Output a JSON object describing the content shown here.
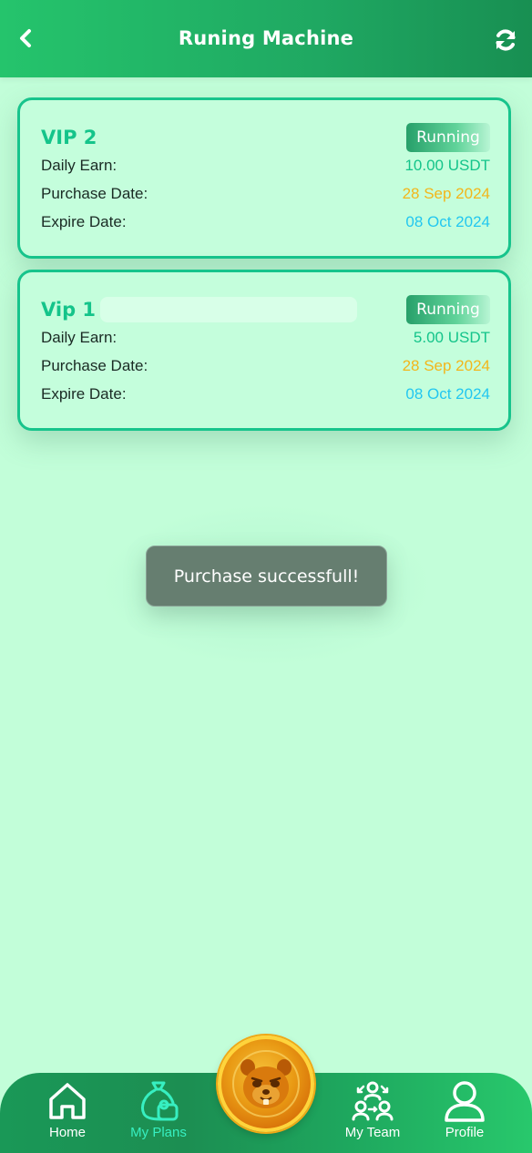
{
  "header": {
    "title": "Runing Machine",
    "back_icon": "chevron-left-icon",
    "refresh_icon": "refresh-icon"
  },
  "plans": [
    {
      "name": "VIP 2",
      "status": "Running",
      "rows": [
        {
          "label": "Daily Earn:",
          "value": "10.00 USDT"
        },
        {
          "label": "Purchase Date:",
          "value": "28 Sep 2024"
        },
        {
          "label": "Expire Date:",
          "value": "08 Oct 2024"
        }
      ]
    },
    {
      "name": "Vip 1",
      "status": "Running",
      "rows": [
        {
          "label": "Daily Earn:",
          "value": "5.00 USDT"
        },
        {
          "label": "Purchase Date:",
          "value": "28 Sep 2024"
        },
        {
          "label": "Expire Date:",
          "value": "08 Oct 2024"
        }
      ]
    }
  ],
  "toast": {
    "message": "Purchase successfull!"
  },
  "nav": {
    "items": [
      {
        "label": "Home",
        "icon": "home-icon",
        "active": false
      },
      {
        "label": "My Plans",
        "icon": "money-bag-icon",
        "active": true
      },
      {
        "label": "My Team",
        "icon": "team-icon",
        "active": false
      },
      {
        "label": "Profile",
        "icon": "profile-icon",
        "active": false
      }
    ],
    "center_icon": "hamster-coin-icon"
  },
  "colors": {
    "background": "#c2fed9",
    "header": "#1fa862",
    "accent": "#14c48a",
    "purchase_date": "#f2b61b",
    "expire_date": "#22c7f0",
    "toast_bg": "#667e70",
    "nav_active": "#37efc1"
  }
}
